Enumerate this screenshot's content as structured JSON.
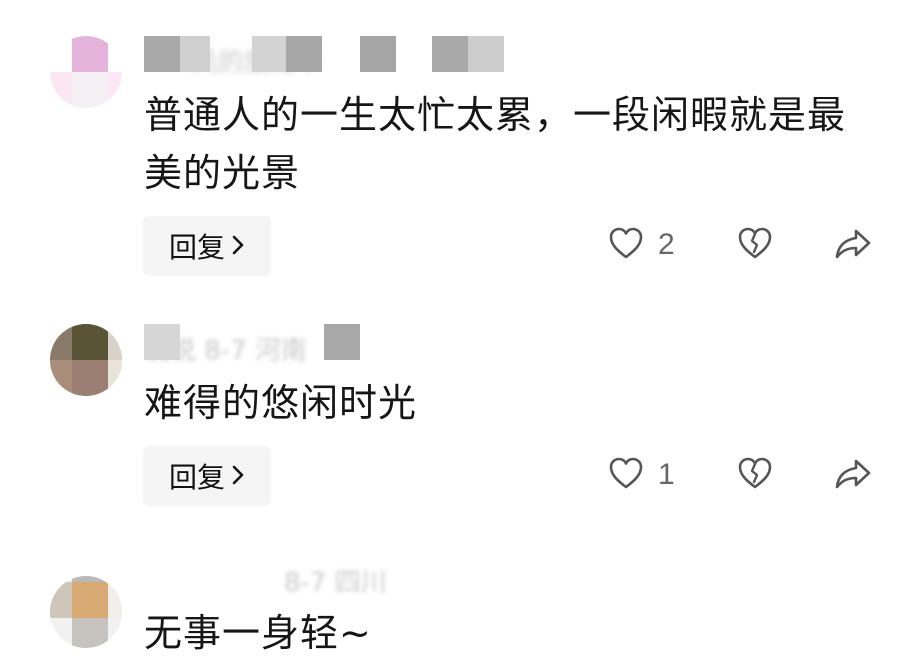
{
  "comments": [
    {
      "meta_text": "风的旅行中",
      "text": "普通人的一生太忙太累，一段闲暇就是最美的光景",
      "reply_label": "回复",
      "like_count": "2"
    },
    {
      "meta_text": "说说 8-7 河南",
      "text": "难得的悠闲时光",
      "reply_label": "回复",
      "like_count": "1"
    },
    {
      "meta_text": "8-7 四川",
      "text": "无事一身轻~"
    }
  ],
  "icons": {
    "like": "heart-outline-icon",
    "dislike": "broken-heart-icon",
    "share": "share-arrow-icon",
    "chevron": "chevron-right-icon"
  },
  "colors": {
    "text": "#161616",
    "secondary": "#666666",
    "reply_bg": "#f5f5f5",
    "icon": "#555555"
  }
}
